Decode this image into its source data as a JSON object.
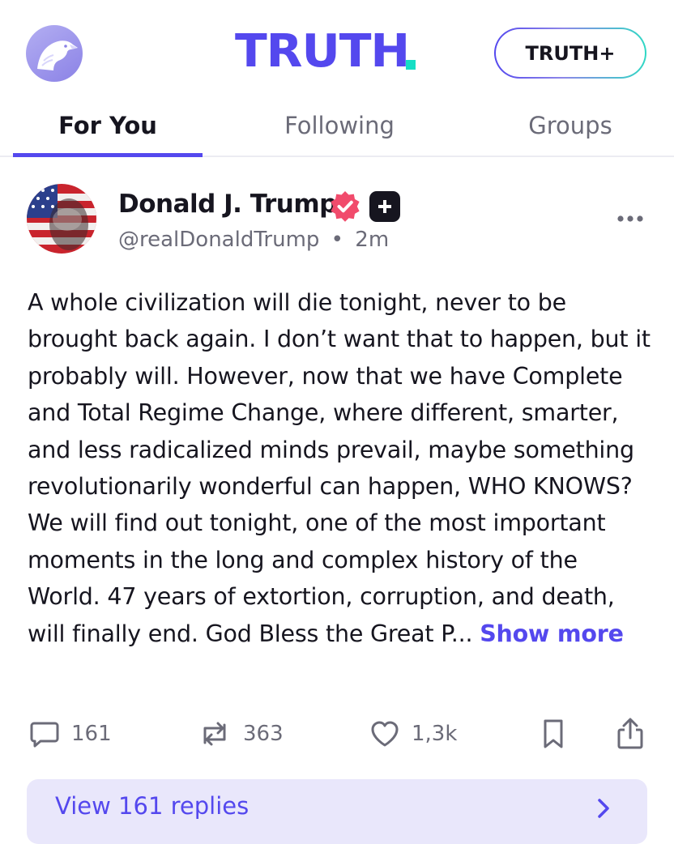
{
  "header": {
    "logo_icon": "eagle-icon",
    "wordmark": "TRUTH",
    "truthplus_label": "TRUTH+",
    "brand_color": "#5448ee",
    "accent_color": "#15dec5"
  },
  "tabs": [
    {
      "label": "For You",
      "active": true
    },
    {
      "label": "Following",
      "active": false
    },
    {
      "label": "Groups",
      "active": false
    }
  ],
  "post": {
    "author_name": "Donald J. Trump",
    "verified_icon": "verified-badge-icon",
    "plus_icon": "plus-badge-icon",
    "handle": "@realDonaldTrump",
    "separator": "•",
    "time": "2m",
    "body": "A whole civilization will die tonight, never to be brought back again. I don’t want that to happen, but it probably will. However, now that we have Complete and Total Regime Change, where different, smarter, and less radicalized minds prevail, maybe something revolutionarily wonderful can happen, WHO KNOWS? We will find out tonight, one of the most important moments in the long and complex history of the World. 47 years of extortion, corruption, and death, will finally end. God Bless the Great P...",
    "show_more": "Show more",
    "more_icon": "more-icon"
  },
  "actions": {
    "replies": {
      "icon": "reply-icon",
      "count": "161"
    },
    "retruths": {
      "icon": "retruth-icon",
      "count": "363"
    },
    "likes": {
      "icon": "heart-icon",
      "count": "1,3k"
    },
    "bookmark": {
      "icon": "bookmark-icon"
    },
    "share": {
      "icon": "share-icon"
    }
  },
  "replies_bar": {
    "label": "View 161 replies",
    "icon": "chevron-right-icon"
  }
}
